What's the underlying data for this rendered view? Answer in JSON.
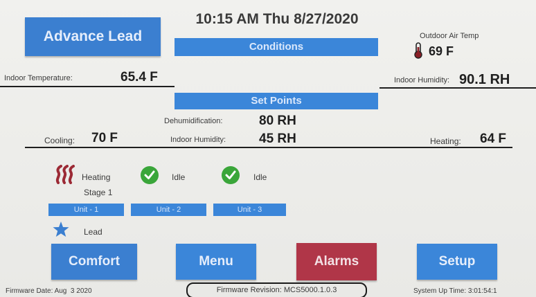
{
  "header": {
    "datetime": "10:15 AM Thu 8/27/2020"
  },
  "top_left_button": {
    "label": "Advance Lead"
  },
  "conditions": {
    "title": "Conditions",
    "outdoor_label": "Outdoor Air Temp",
    "outdoor_value": "69 F",
    "indoor_temp_label": "Indoor Temperature:",
    "indoor_temp_value": "65.4 F",
    "indoor_humidity_label": "Indoor Humidity:",
    "indoor_humidity_value": "90.1 RH"
  },
  "setpoints": {
    "title": "Set Points",
    "dehum_label": "Dehumidification:",
    "dehum_value": "80 RH",
    "indoor_hum_label": "Indoor Humidity:",
    "indoor_hum_value": "45 RH",
    "cooling_label": "Cooling:",
    "cooling_value": "70 F",
    "heating_label": "Heating:",
    "heating_value": "64 F"
  },
  "units": {
    "unit1": {
      "status": "Heating",
      "stage": "Stage 1",
      "label": "Unit - 1"
    },
    "unit2": {
      "status": "Idle",
      "label": "Unit - 2"
    },
    "unit3": {
      "status": "Idle",
      "label": "Unit - 3"
    },
    "lead_label": "Lead"
  },
  "nav": {
    "comfort": "Comfort",
    "menu": "Menu",
    "alarms": "Alarms",
    "setup": "Setup"
  },
  "footer": {
    "firmware_date": "Firmware Date: Aug  3 2020",
    "firmware_revision": "Firmware Revision: MCS5000.1.0.3",
    "system_uptime": "System Up Time: 3:01:54:1"
  },
  "colors": {
    "accent_blue": "#3b86d9",
    "alarm_red": "#b03648",
    "check_green": "#3aa63a",
    "heating_red": "#9c2a35"
  }
}
